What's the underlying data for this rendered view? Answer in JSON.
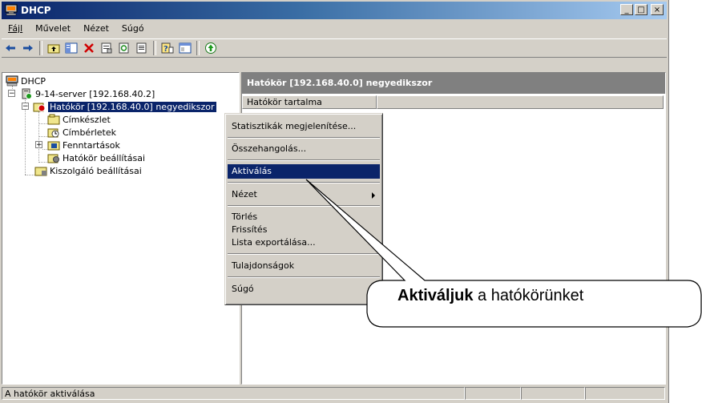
{
  "window": {
    "title": "DHCP",
    "controls": [
      "_",
      "□",
      "×"
    ]
  },
  "menu": [
    {
      "label": "Fájl"
    },
    {
      "label": "Művelet"
    },
    {
      "label": "Nézet"
    },
    {
      "label": "Súgó"
    }
  ],
  "tree": {
    "root": "DHCP",
    "server": "9-14-server [192.168.40.2]",
    "scope": "Hatókör [192.168.40.0] negyedikszor",
    "children": [
      "Címkészlet",
      "Címbérletek",
      "Fenntartások",
      "Hatókör beállításai"
    ],
    "server_options": "Kiszolgáló beállításai"
  },
  "right_pane": {
    "header": "Hatókör [192.168.40.0] negyedikszor",
    "column": "Hatókör tartalma"
  },
  "context_menu": {
    "stats": "Statisztikák megjelenítése...",
    "reconcile": "Összehangolás...",
    "activate": "Aktiválás",
    "view": "Nézet",
    "delete": "Törlés",
    "refresh": "Frissítés",
    "export": "Lista exportálása...",
    "properties": "Tulajdonságok",
    "help": "Súgó"
  },
  "status": {
    "text": "A hatókör aktiválása"
  },
  "callout": {
    "bold": "Aktiváljuk",
    "rest": " a hatókörünket"
  }
}
